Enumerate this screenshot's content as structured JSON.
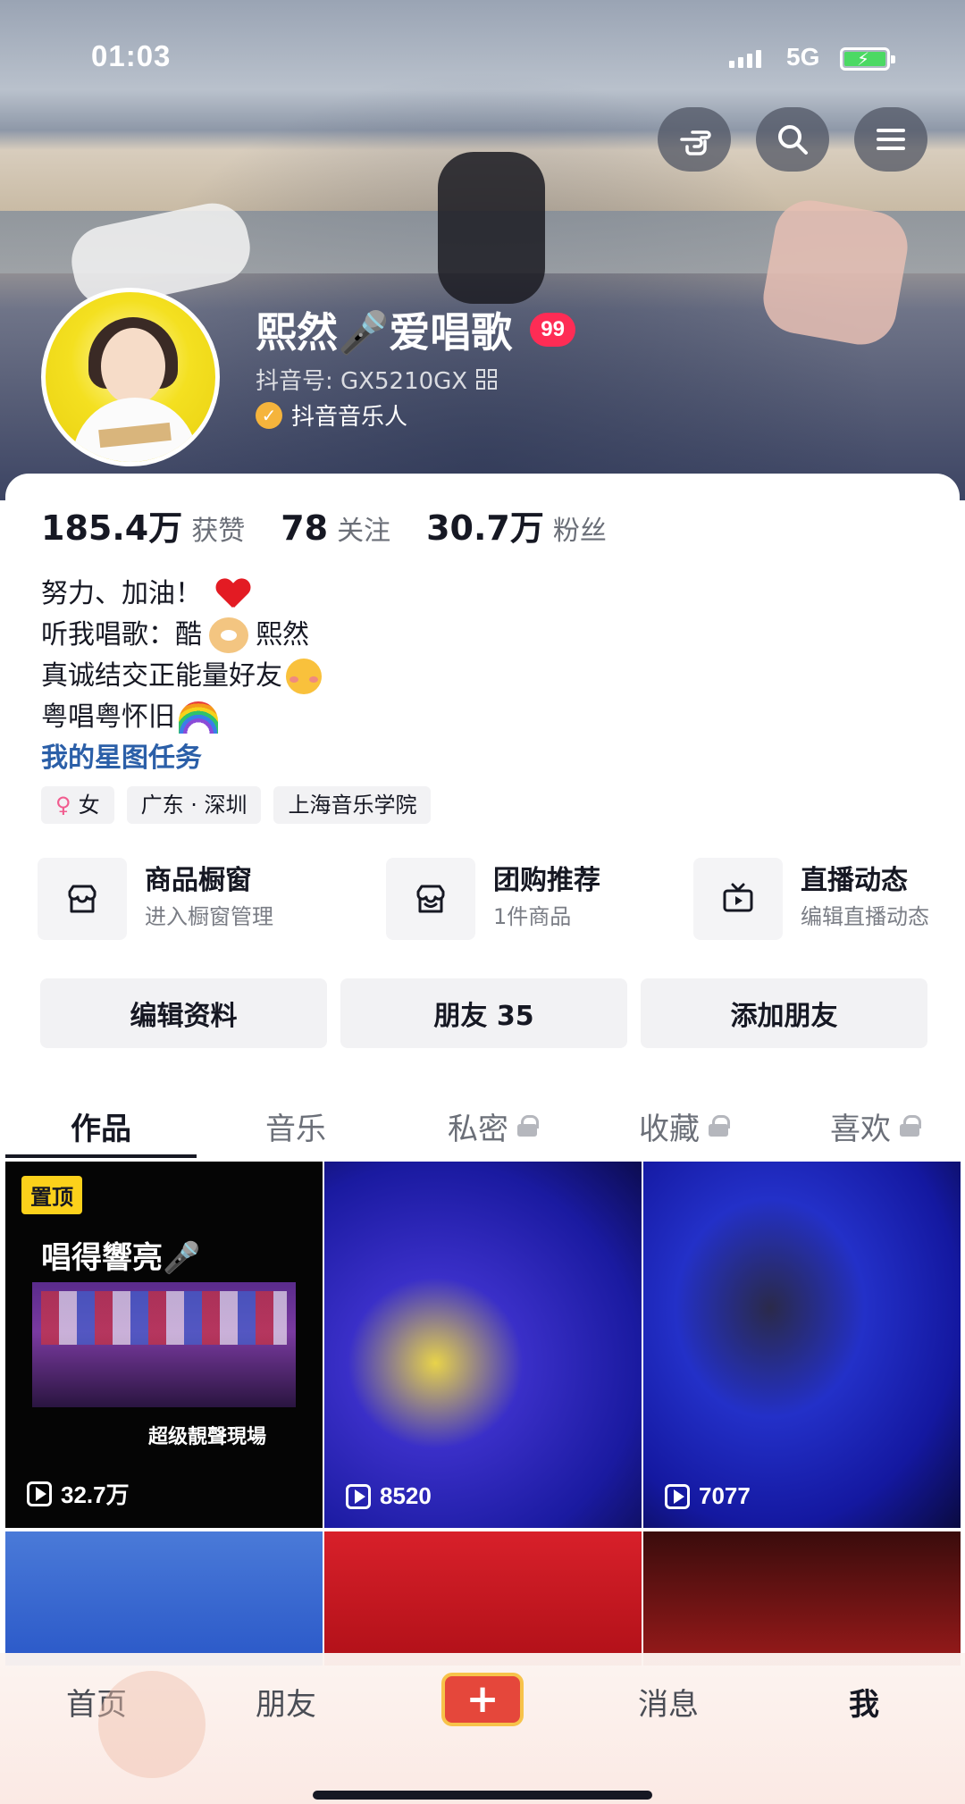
{
  "status_bar": {
    "time": "01:03",
    "network": "5G"
  },
  "header": {
    "nickname": "熙然🎤爱唱歌",
    "level": "99",
    "douyin_id": "抖音号: GX5210GX",
    "verification": "抖音音乐人",
    "icons": [
      "visitor-hand-icon",
      "search-icon",
      "menu-icon"
    ]
  },
  "stats": [
    {
      "value": "185.4万",
      "label": "获赞"
    },
    {
      "value": "78",
      "label": "关注"
    },
    {
      "value": "30.7万",
      "label": "粉丝"
    }
  ],
  "bio": {
    "line1": "努力、加油！",
    "line2_a": "听我唱歌：酷",
    "line2_b": "熙然",
    "line3": "真诚结交正能量好友",
    "line4": "粤唱粤怀旧",
    "link": "我的星图任务"
  },
  "tags": {
    "gender": "女",
    "location": "广东 · 深圳",
    "school": "上海音乐学院"
  },
  "services": [
    {
      "title": "商品橱窗",
      "sub": "进入橱窗管理",
      "icon": "shop-icon"
    },
    {
      "title": "团购推荐",
      "sub": "1件商品",
      "icon": "group-buy-icon"
    },
    {
      "title": "直播动态",
      "sub": "编辑直播动态",
      "icon": "tv-icon"
    }
  ],
  "actions": {
    "edit": "编辑资料",
    "friends": "朋友 35",
    "add_friend": "添加朋友"
  },
  "tabs": [
    {
      "label": "作品",
      "locked": false
    },
    {
      "label": "音乐",
      "locked": false
    },
    {
      "label": "私密",
      "locked": true
    },
    {
      "label": "收藏",
      "locked": true
    },
    {
      "label": "喜欢",
      "locked": true
    }
  ],
  "videos": [
    {
      "pinned_label": "置顶",
      "title": "唱得響亮🎤",
      "caption": "超级靚聲現場",
      "views": "32.7万"
    },
    {
      "views": "8520"
    },
    {
      "views": "7077"
    }
  ],
  "bottom_nav": {
    "home": "首页",
    "friends": "朋友",
    "plus": "+",
    "messages": "消息",
    "me": "我"
  },
  "colors": {
    "accent_red": "#fe2c55",
    "link_blue": "#2b5fa8",
    "pin_yellow": "#fcd11b",
    "verify_orange": "#f5b43c"
  }
}
